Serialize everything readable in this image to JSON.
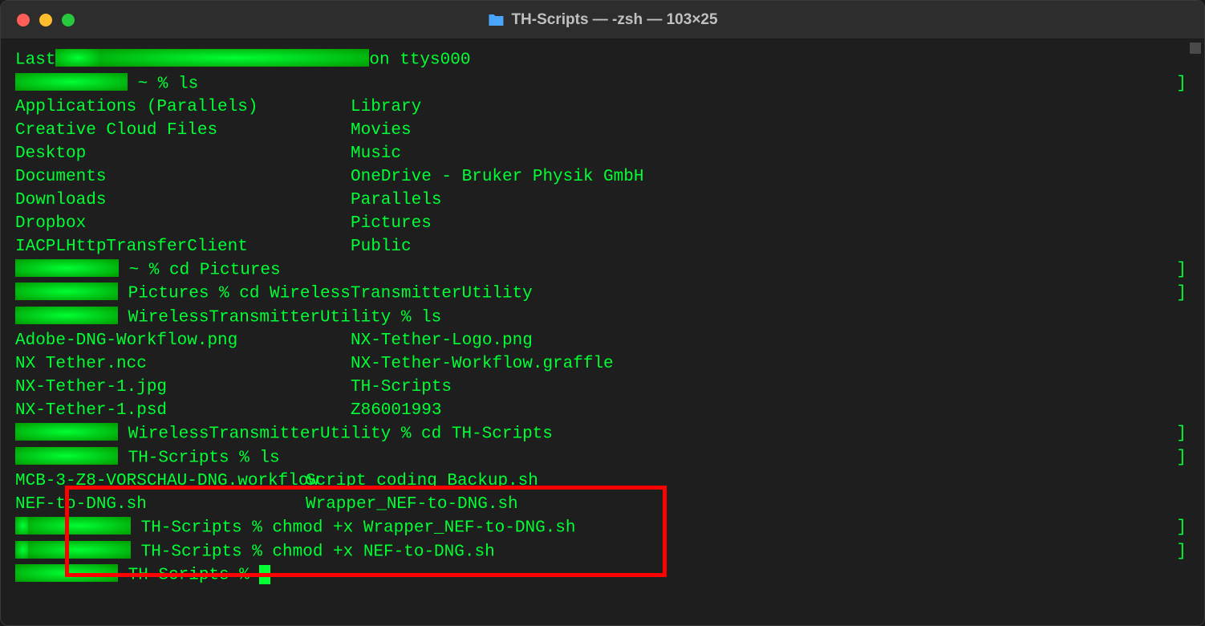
{
  "window": {
    "title": "TH-Scripts — -zsh — 103×25"
  },
  "lines": {
    "lastLogin1": "Last",
    "lastLogin2": "on ttys000",
    "prompt1_suffix": " ~ % ls",
    "ls1": {
      "col1": [
        "Applications (Parallels)",
        "Creative Cloud Files",
        "Desktop",
        "Documents",
        "Downloads",
        "Dropbox",
        "IACPLHttpTransferClient"
      ],
      "col2": [
        "Library",
        "Movies",
        "Music",
        "OneDrive - Bruker Physik GmbH",
        "Parallels",
        "Pictures",
        "Public"
      ]
    },
    "prompt2_suffix": " ~ % cd Pictures",
    "prompt3_suffix": " Pictures % cd WirelessTransmitterUtility",
    "prompt4_suffix": " WirelessTransmitterUtility % ls",
    "ls2": {
      "col1": [
        "Adobe-DNG-Workflow.png",
        "NX Tether.ncc",
        "NX-Tether-1.jpg",
        "NX-Tether-1.psd"
      ],
      "col2": [
        "NX-Tether-Logo.png",
        "NX-Tether-Workflow.graffle",
        "TH-Scripts",
        "Z86001993"
      ]
    },
    "prompt5_suffix": " WirelessTransmitterUtility % cd TH-Scripts",
    "prompt6_suffix": " TH-Scripts % ls",
    "ls3": {
      "col1": [
        "MCB-3-Z8-VORSCHAU-DNG.workflow",
        "NEF-to-DNG.sh"
      ],
      "col2": [
        "Script_coding_Backup.sh",
        "Wrapper_NEF-to-DNG.sh"
      ]
    },
    "prompt7_suffix": " TH-Scripts % chmod +x Wrapper_NEF-to-DNG.sh",
    "prompt8_suffix": " TH-Scripts % chmod +x NEF-to-DNG.sh",
    "prompt9_suffix": " TH-Scripts % "
  }
}
